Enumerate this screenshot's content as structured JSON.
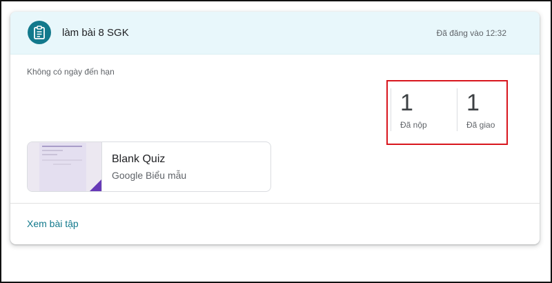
{
  "assignment": {
    "icon": "assignment-icon",
    "title": "làm bài 8 SGK",
    "posted": "Đã đăng vào 12:32",
    "due": "Không có ngày đến hạn"
  },
  "stats": [
    {
      "value": "1",
      "label": "Đã nộp"
    },
    {
      "value": "1",
      "label": "Đã giao"
    }
  ],
  "attachment": {
    "title": "Blank Quiz",
    "subtitle": "Google Biểu mẫu",
    "icon": "google-forms-thumbnail"
  },
  "footer": {
    "link_label": "Xem bài tập"
  },
  "colors": {
    "accent": "#12798c",
    "header_bg": "#e8f7fb",
    "highlight_border": "#d8141c",
    "forms_purple": "#673ab7"
  }
}
